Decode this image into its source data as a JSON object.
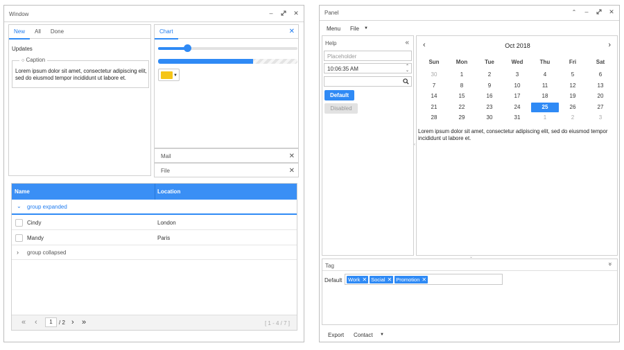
{
  "window": {
    "title": "Window",
    "tabs": [
      "New",
      "All",
      "Done"
    ],
    "updates_label": "Updates",
    "caption": "Caption",
    "lorem": "Lorem ipsum dolor sit amet, consectetur adipiscing elit, sed do eiusmod tempor incididunt ut labore et.",
    "chart_tab": "Chart",
    "slider_value": 0.21,
    "progress_value": 0.68,
    "color_swatch": "#f5c518",
    "mail_label": "Mail",
    "file_label": "File",
    "grid": {
      "headers": [
        "Name",
        "Location"
      ],
      "group_expanded": "group expanded",
      "rows": [
        {
          "name": "Cindy",
          "location": "London"
        },
        {
          "name": "Mandy",
          "location": "Paris"
        }
      ],
      "group_collapsed": "group collapsed",
      "page_current": "1",
      "page_total": "/ 2",
      "range": "[ 1 - 4 / 7 ]"
    }
  },
  "panel": {
    "title": "Panel",
    "menu": [
      "Menu",
      "File"
    ],
    "help": {
      "title": "Help",
      "placeholder": "Placeholder",
      "time": "10:06:35 AM",
      "default_btn": "Default",
      "disabled_btn": "Disabled"
    },
    "calendar": {
      "month": "Oct 2018",
      "weekdays": [
        "Sun",
        "Mon",
        "Tue",
        "Wed",
        "Thu",
        "Fri",
        "Sat"
      ],
      "weeks": [
        [
          "30",
          "1",
          "2",
          "3",
          "4",
          "5",
          "6"
        ],
        [
          "7",
          "8",
          "9",
          "10",
          "11",
          "12",
          "13"
        ],
        [
          "14",
          "15",
          "16",
          "17",
          "18",
          "19",
          "20"
        ],
        [
          "21",
          "22",
          "23",
          "24",
          "25",
          "26",
          "27"
        ],
        [
          "28",
          "29",
          "30",
          "31",
          "1",
          "2",
          "3"
        ]
      ],
      "selected": "25",
      "lorem": "Lorem ipsum dolor sit amet, consectetur adipiscing elit, sed do eiusmod tempor incididunt ut labore et."
    },
    "tag": {
      "title": "Tag",
      "label": "Default",
      "chips": [
        "Work",
        "Social",
        "Promotion"
      ]
    },
    "footer": [
      "Export",
      "Contact"
    ]
  },
  "colors": {
    "accent": "#2f8af5",
    "header_bg": "#3a8ff5",
    "swatch": "#f5c518"
  }
}
